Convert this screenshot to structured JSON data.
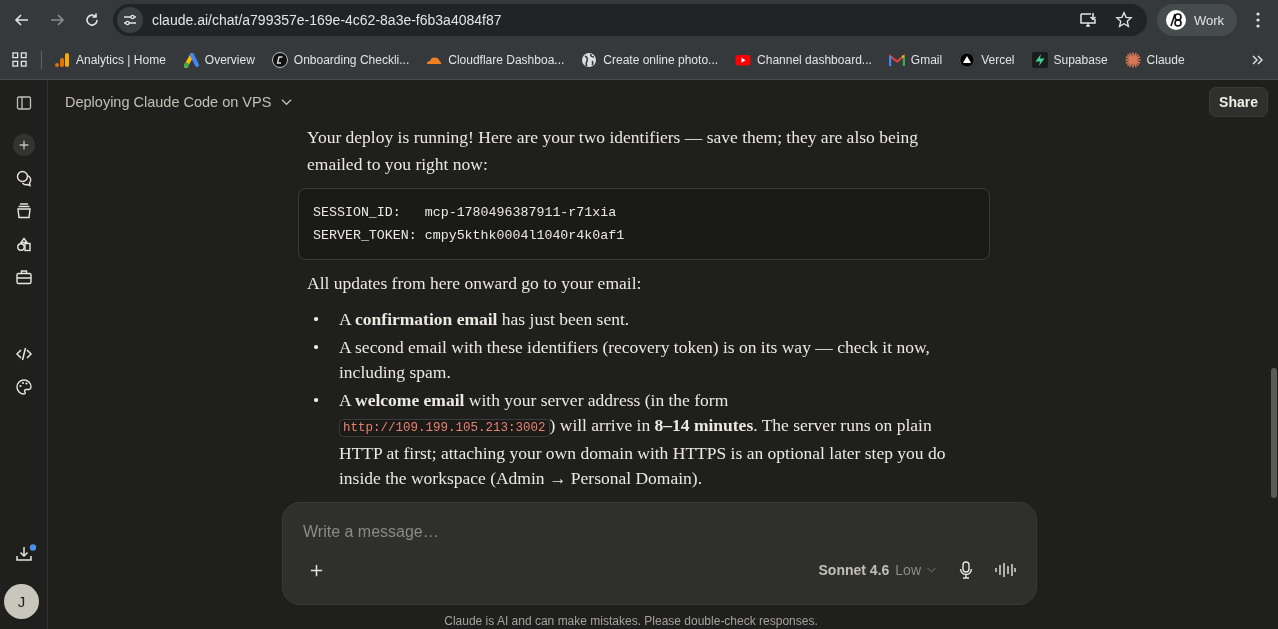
{
  "browser": {
    "url": "claude.ai/chat/a799357e-169e-4c62-8a3e-f6b3a4084f87",
    "profile": "Work"
  },
  "bookmarks": [
    {
      "label": "Analytics | Home",
      "kind": "analytics"
    },
    {
      "label": "Overview",
      "kind": "ads"
    },
    {
      "label": "Onboarding Checkli...",
      "kind": "circle"
    },
    {
      "label": "Cloudflare Dashboa...",
      "kind": "cloud"
    },
    {
      "label": "Create online photo...",
      "kind": "globe"
    },
    {
      "label": "Channel dashboard...",
      "kind": "youtube"
    },
    {
      "label": "Gmail",
      "kind": "gmail"
    },
    {
      "label": "Vercel",
      "kind": "vercel"
    },
    {
      "label": "Supabase",
      "kind": "supabase"
    },
    {
      "label": "Claude",
      "kind": "claude"
    }
  ],
  "avatar": "J",
  "conversation": {
    "title": "Deploying Claude Code on VPS",
    "share": "Share"
  },
  "message": {
    "intro": "Your deploy is running! Here are your two identifiers — save them; they are also being emailed to you right now:",
    "code_lines": [
      {
        "key": "SESSION_ID:   ",
        "value": "mcp-1780496387911-r71xia"
      },
      {
        "key": "SERVER_TOKEN: ",
        "value": "cmpy5kthk0004l1040r4k0af1"
      }
    ],
    "updates": "All updates from here onward go to your email:",
    "bullets": [
      {
        "marker": "•",
        "parts": [
          {
            "kind": "text",
            "text": "A **confirmation email** has just been sent."
          }
        ]
      },
      {
        "marker": "•",
        "parts": [
          {
            "kind": "text",
            "text": "A second email with these identifiers (recovery token) is on its way — check it now, including spam."
          }
        ]
      },
      {
        "marker": "•",
        "parts": [
          {
            "kind": "text",
            "text": "A **welcome email** with your server address (in the form "
          },
          {
            "kind": "code",
            "text": "http://109.199.105.213:3002"
          },
          {
            "kind": "text",
            "text": ") will arrive in **8–14 minutes**. The server runs on plain HTTP at first; attaching your own domain with HTTPS is an optional later step you do inside the workspace (Admin → Personal Domain)."
          }
        ]
      }
    ]
  },
  "composer": {
    "placeholder": "Write a message…",
    "model": "Sonnet 4.6",
    "effort": "Low"
  },
  "disclaimer": "Claude is AI and can make mistakes. Please double-check responses."
}
